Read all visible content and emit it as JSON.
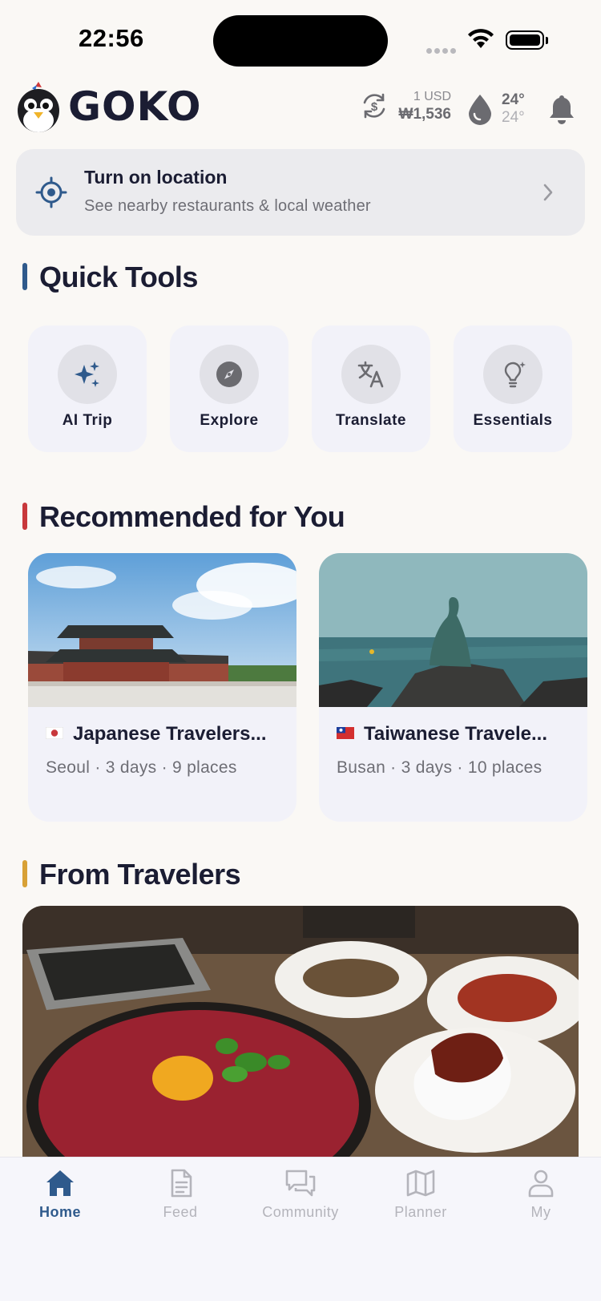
{
  "status_bar": {
    "time": "22:56"
  },
  "header": {
    "brand": "GOKO",
    "exchange": {
      "unit": "1 USD",
      "rate": "₩1,536"
    },
    "weather": {
      "high": "24°",
      "low": "24°"
    }
  },
  "location_banner": {
    "title": "Turn on location",
    "subtitle": "See nearby restaurants & local weather"
  },
  "quick_tools": {
    "title": "Quick Tools",
    "accent": "#2f5a8c",
    "items": [
      {
        "label": "AI Trip",
        "icon": "sparkles-icon"
      },
      {
        "label": "Explore",
        "icon": "compass-icon"
      },
      {
        "label": "Translate",
        "icon": "translate-icon"
      },
      {
        "label": "Essentials",
        "icon": "lightbulb-icon"
      }
    ]
  },
  "recommended": {
    "title": "Recommended for You",
    "accent": "#c8383c",
    "items": [
      {
        "title": "Japanese Travelers...",
        "flag": "japan-flag",
        "meta": "Seoul · 3 days · 9 places"
      },
      {
        "title": "Taiwanese Travele...",
        "flag": "taiwan-flag",
        "meta": "Busan · 3 days · 10 places"
      }
    ]
  },
  "from_travelers": {
    "title": "From Travelers",
    "accent": "#d8a136"
  },
  "tab_bar": {
    "items": [
      {
        "label": "Home",
        "icon": "home-icon",
        "active": true
      },
      {
        "label": "Feed",
        "icon": "document-icon",
        "active": false
      },
      {
        "label": "Community",
        "icon": "chat-icon",
        "active": false
      },
      {
        "label": "Planner",
        "icon": "map-icon",
        "active": false
      },
      {
        "label": "My",
        "icon": "person-icon",
        "active": false
      }
    ]
  }
}
